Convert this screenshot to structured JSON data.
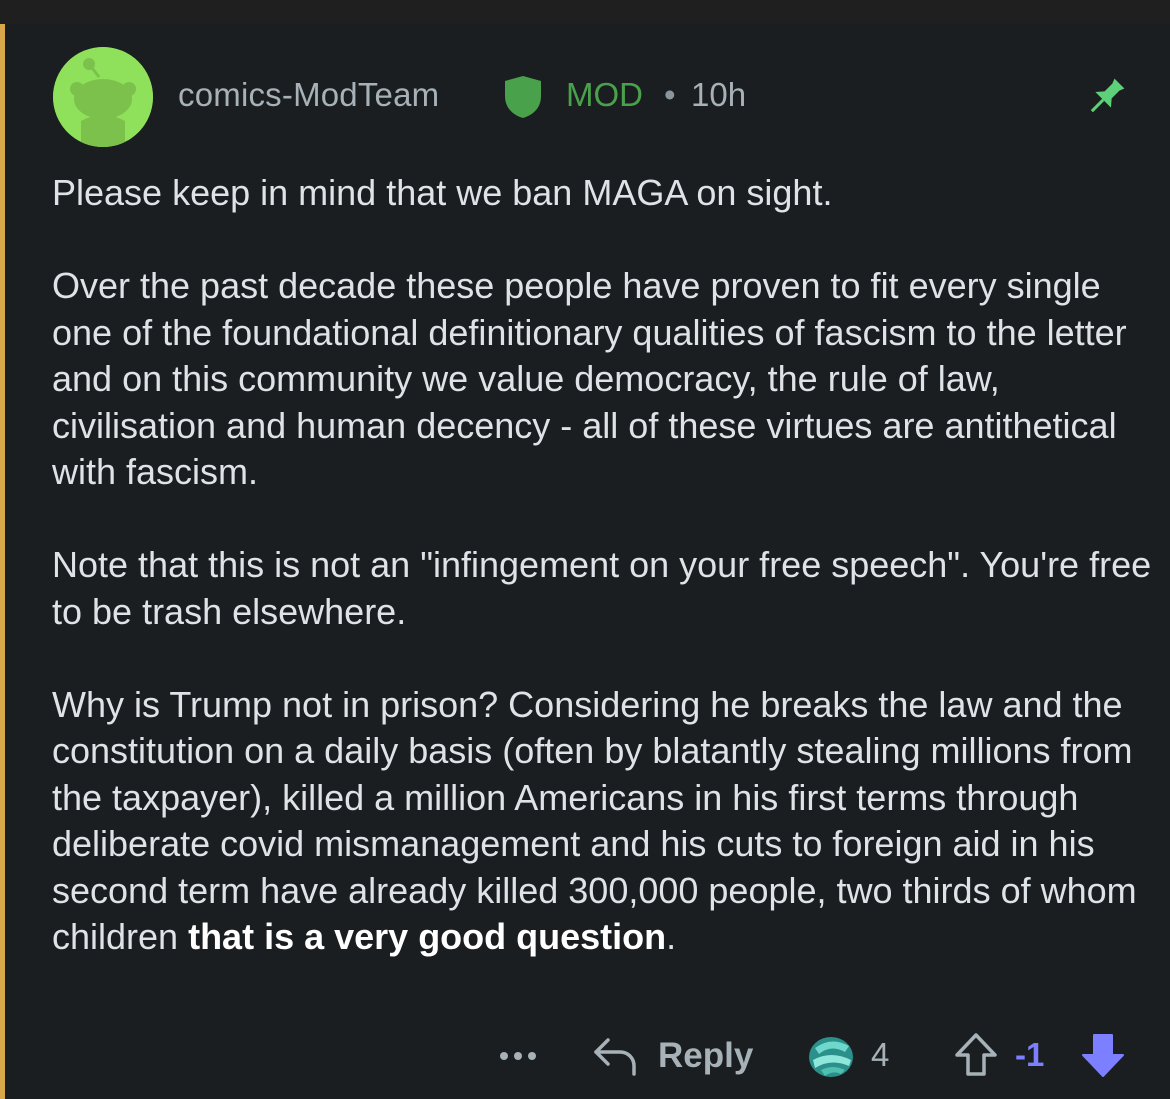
{
  "comment": {
    "username": "comics-ModTeam",
    "mod_label": "MOD",
    "separator": "•",
    "time": "10h",
    "paragraphs": [
      "Please keep in mind that we ban MAGA on sight.",
      "Over the past decade these people have proven to fit every single one of the foundational definitionary qualities of fascism to the letter and on this community we value democracy, the rule of law, civilisation and human decency - all of these virtues are antithetical with fascism.",
      "Note that this is not an \"infingement on your free speech\". You're free to be trash elsewhere."
    ],
    "last_paragraph": {
      "plain": "Why is Trump not in prison? Considering he breaks the law and the constitution on a daily basis (often by blatantly stealing millions from the taxpayer), killed a million Americans in his first terms through deliberate covid mismanagement and his cuts to foreign aid in his second term have already killed 300,000 people, two thirds of whom children ",
      "bold": "that is a very good question",
      "end": "."
    }
  },
  "actions": {
    "more_icon": "ellipsis-icon",
    "reply_label": "Reply",
    "award_icon": "award-icon",
    "award_count": "4",
    "score": "-1"
  },
  "colors": {
    "background": "#1b1e20",
    "thread_line": "#d7a74a",
    "mod_green": "#4aa14b",
    "pin_green": "#5fd07a",
    "avatar_green": "#8fe15b",
    "vote_purple": "#7c7fff"
  }
}
